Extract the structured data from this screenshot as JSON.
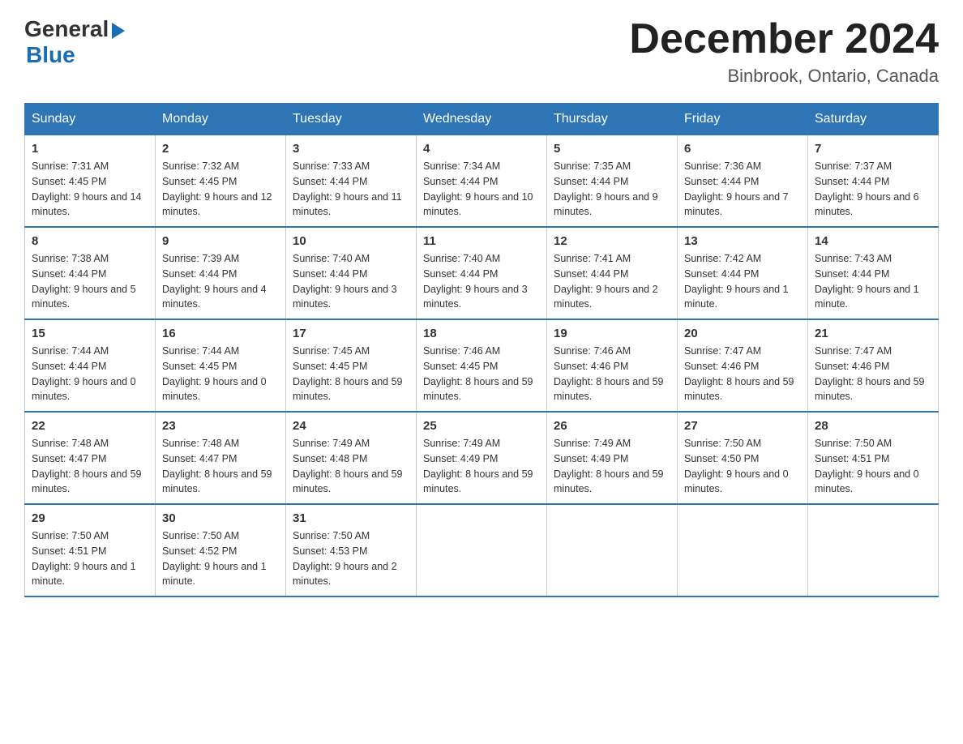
{
  "logo": {
    "general": "General",
    "arrow": "▶",
    "blue": "Blue"
  },
  "title": "December 2024",
  "location": "Binbrook, Ontario, Canada",
  "days_of_week": [
    "Sunday",
    "Monday",
    "Tuesday",
    "Wednesday",
    "Thursday",
    "Friday",
    "Saturday"
  ],
  "weeks": [
    [
      {
        "day": "1",
        "sunrise": "7:31 AM",
        "sunset": "4:45 PM",
        "daylight": "9 hours and 14 minutes."
      },
      {
        "day": "2",
        "sunrise": "7:32 AM",
        "sunset": "4:45 PM",
        "daylight": "9 hours and 12 minutes."
      },
      {
        "day": "3",
        "sunrise": "7:33 AM",
        "sunset": "4:44 PM",
        "daylight": "9 hours and 11 minutes."
      },
      {
        "day": "4",
        "sunrise": "7:34 AM",
        "sunset": "4:44 PM",
        "daylight": "9 hours and 10 minutes."
      },
      {
        "day": "5",
        "sunrise": "7:35 AM",
        "sunset": "4:44 PM",
        "daylight": "9 hours and 9 minutes."
      },
      {
        "day": "6",
        "sunrise": "7:36 AM",
        "sunset": "4:44 PM",
        "daylight": "9 hours and 7 minutes."
      },
      {
        "day": "7",
        "sunrise": "7:37 AM",
        "sunset": "4:44 PM",
        "daylight": "9 hours and 6 minutes."
      }
    ],
    [
      {
        "day": "8",
        "sunrise": "7:38 AM",
        "sunset": "4:44 PM",
        "daylight": "9 hours and 5 minutes."
      },
      {
        "day": "9",
        "sunrise": "7:39 AM",
        "sunset": "4:44 PM",
        "daylight": "9 hours and 4 minutes."
      },
      {
        "day": "10",
        "sunrise": "7:40 AM",
        "sunset": "4:44 PM",
        "daylight": "9 hours and 3 minutes."
      },
      {
        "day": "11",
        "sunrise": "7:40 AM",
        "sunset": "4:44 PM",
        "daylight": "9 hours and 3 minutes."
      },
      {
        "day": "12",
        "sunrise": "7:41 AM",
        "sunset": "4:44 PM",
        "daylight": "9 hours and 2 minutes."
      },
      {
        "day": "13",
        "sunrise": "7:42 AM",
        "sunset": "4:44 PM",
        "daylight": "9 hours and 1 minute."
      },
      {
        "day": "14",
        "sunrise": "7:43 AM",
        "sunset": "4:44 PM",
        "daylight": "9 hours and 1 minute."
      }
    ],
    [
      {
        "day": "15",
        "sunrise": "7:44 AM",
        "sunset": "4:44 PM",
        "daylight": "9 hours and 0 minutes."
      },
      {
        "day": "16",
        "sunrise": "7:44 AM",
        "sunset": "4:45 PM",
        "daylight": "9 hours and 0 minutes."
      },
      {
        "day": "17",
        "sunrise": "7:45 AM",
        "sunset": "4:45 PM",
        "daylight": "8 hours and 59 minutes."
      },
      {
        "day": "18",
        "sunrise": "7:46 AM",
        "sunset": "4:45 PM",
        "daylight": "8 hours and 59 minutes."
      },
      {
        "day": "19",
        "sunrise": "7:46 AM",
        "sunset": "4:46 PM",
        "daylight": "8 hours and 59 minutes."
      },
      {
        "day": "20",
        "sunrise": "7:47 AM",
        "sunset": "4:46 PM",
        "daylight": "8 hours and 59 minutes."
      },
      {
        "day": "21",
        "sunrise": "7:47 AM",
        "sunset": "4:46 PM",
        "daylight": "8 hours and 59 minutes."
      }
    ],
    [
      {
        "day": "22",
        "sunrise": "7:48 AM",
        "sunset": "4:47 PM",
        "daylight": "8 hours and 59 minutes."
      },
      {
        "day": "23",
        "sunrise": "7:48 AM",
        "sunset": "4:47 PM",
        "daylight": "8 hours and 59 minutes."
      },
      {
        "day": "24",
        "sunrise": "7:49 AM",
        "sunset": "4:48 PM",
        "daylight": "8 hours and 59 minutes."
      },
      {
        "day": "25",
        "sunrise": "7:49 AM",
        "sunset": "4:49 PM",
        "daylight": "8 hours and 59 minutes."
      },
      {
        "day": "26",
        "sunrise": "7:49 AM",
        "sunset": "4:49 PM",
        "daylight": "8 hours and 59 minutes."
      },
      {
        "day": "27",
        "sunrise": "7:50 AM",
        "sunset": "4:50 PM",
        "daylight": "9 hours and 0 minutes."
      },
      {
        "day": "28",
        "sunrise": "7:50 AM",
        "sunset": "4:51 PM",
        "daylight": "9 hours and 0 minutes."
      }
    ],
    [
      {
        "day": "29",
        "sunrise": "7:50 AM",
        "sunset": "4:51 PM",
        "daylight": "9 hours and 1 minute."
      },
      {
        "day": "30",
        "sunrise": "7:50 AM",
        "sunset": "4:52 PM",
        "daylight": "9 hours and 1 minute."
      },
      {
        "day": "31",
        "sunrise": "7:50 AM",
        "sunset": "4:53 PM",
        "daylight": "9 hours and 2 minutes."
      },
      null,
      null,
      null,
      null
    ]
  ],
  "labels": {
    "sunrise": "Sunrise:",
    "sunset": "Sunset:",
    "daylight": "Daylight:"
  }
}
